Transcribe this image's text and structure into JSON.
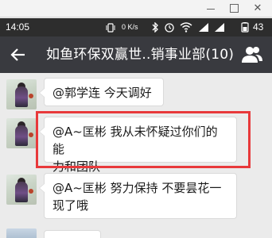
{
  "window": {
    "minimize_label": "",
    "maximize_label": "",
    "close_label": "✕"
  },
  "status_bar": {
    "time": "14:05",
    "network_speed": "0 K/s",
    "battery": "43"
  },
  "header": {
    "title": "如鱼环保双赢世..销事业部(10)"
  },
  "messages": [
    {
      "text": "@郭学连   今天调好"
    },
    {
      "text_line1": "@A~匡彬  我从未怀疑过你们的能",
      "text_line2": "力和团队"
    },
    {
      "text_line1": "@A~匡彬  努力保持   不要昙花一",
      "text_line2": "现了哦"
    }
  ],
  "colors": {
    "titlebar": "#393a3f",
    "statusbar": "#2d2d2d",
    "chat_background": "#ebebeb",
    "highlight_box": "#e8393b"
  }
}
